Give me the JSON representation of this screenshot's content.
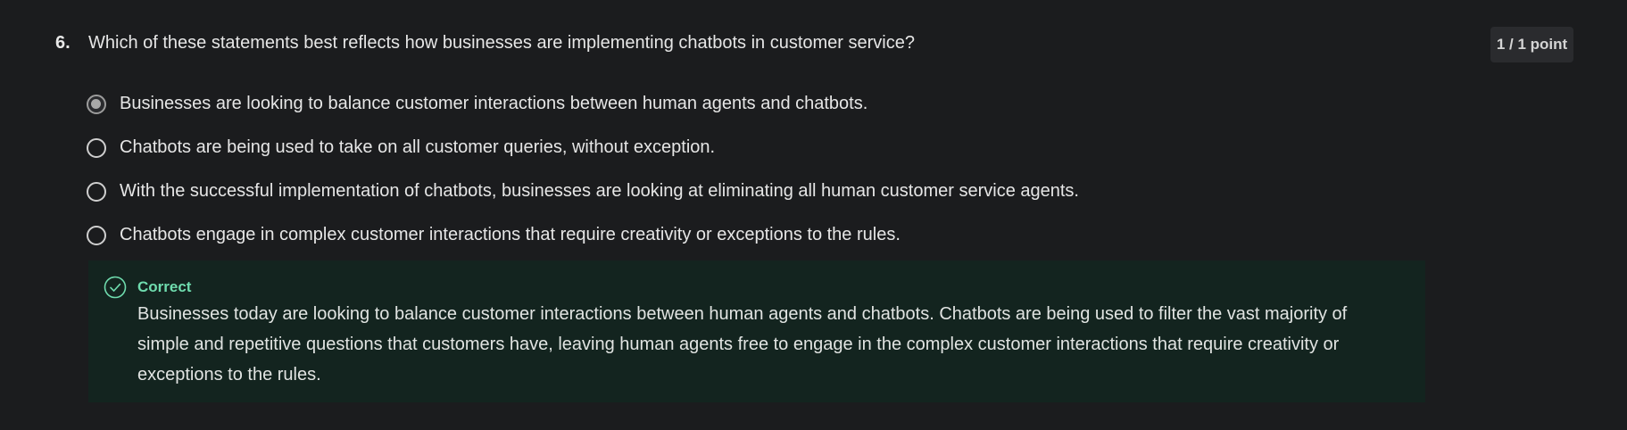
{
  "question": {
    "number": "6.",
    "text": "Which of these statements best reflects how businesses are implementing chatbots in customer service?",
    "points": "1 / 1 point"
  },
  "options": [
    {
      "label": "Businesses are looking to balance customer interactions between human agents and chatbots.",
      "selected": true
    },
    {
      "label": "Chatbots are being used to take on all customer queries, without exception.",
      "selected": false
    },
    {
      "label": "With the successful implementation of chatbots, businesses are looking at eliminating all human customer service agents.",
      "selected": false
    },
    {
      "label": "Chatbots engage in complex customer interactions that require creativity or exceptions to the rules.",
      "selected": false
    }
  ],
  "feedback": {
    "status": "Correct",
    "icon": "check-circle-icon",
    "text": "Businesses today are looking to balance customer interactions between human agents and chatbots. Chatbots are being used to filter the vast majority of simple and repetitive questions that customers have, leaving human agents free to engage in the complex customer interactions that require creativity or exceptions to the rules."
  },
  "colors": {
    "background": "#1b1c1e",
    "feedback_background": "#13241f",
    "correct_accent": "#6fdcae"
  }
}
